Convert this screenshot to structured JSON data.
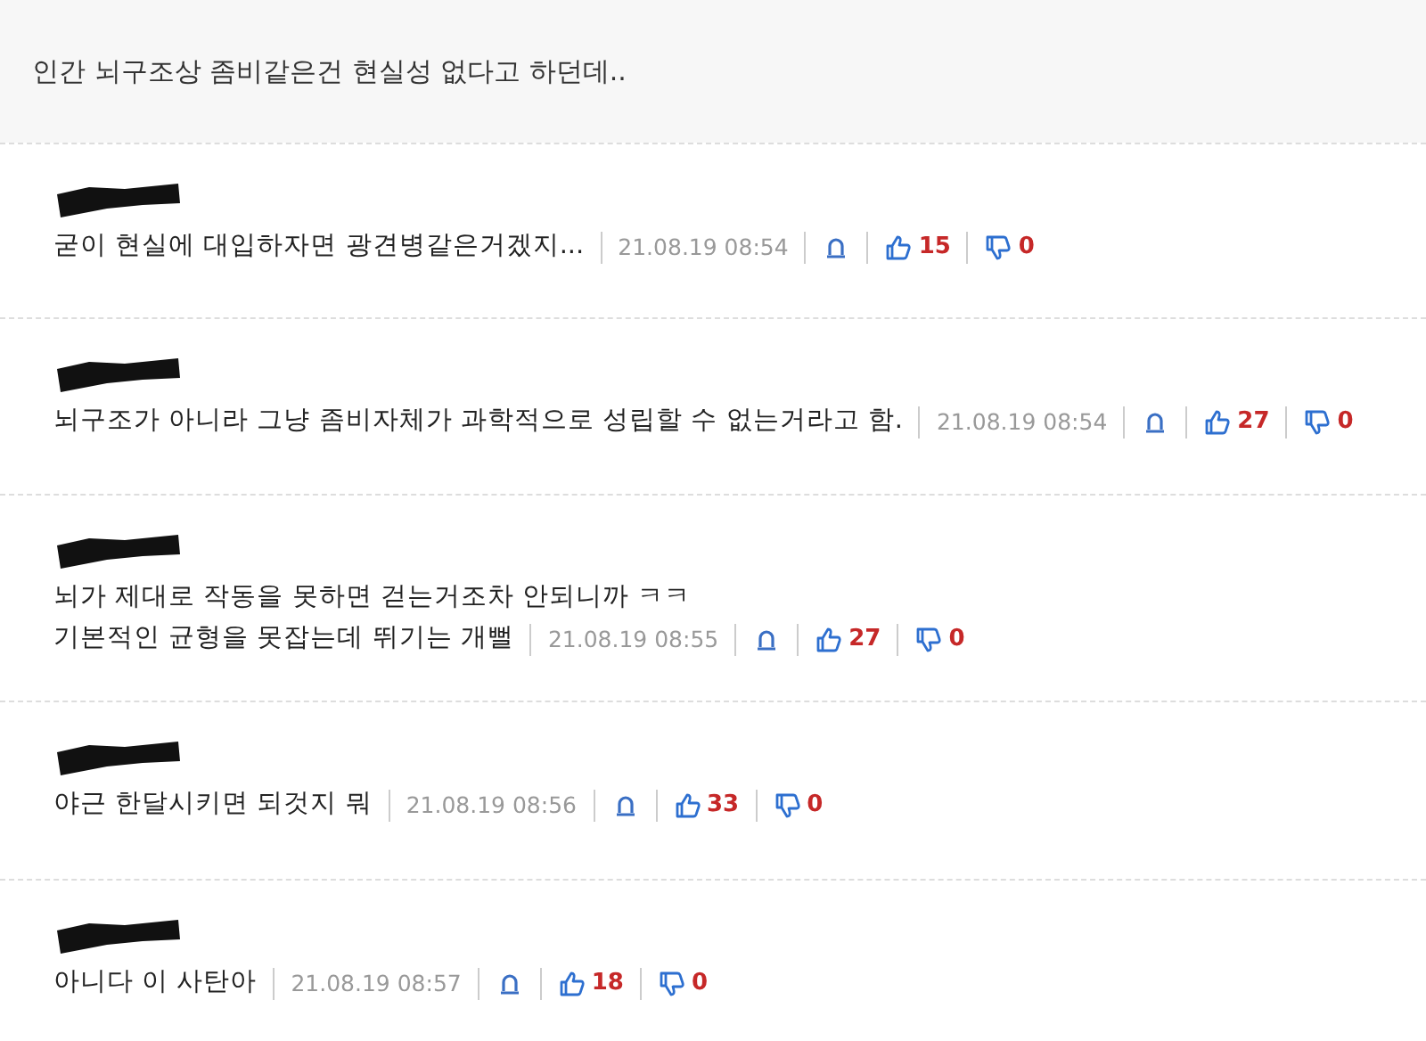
{
  "post": {
    "text": "인간 뇌구조상 좀비같은건 현실성 없다고 하던데.."
  },
  "comments": [
    {
      "lines": [
        "굳이 현실에 대입하자면 광견병같은거겠지..."
      ],
      "time": "21.08.19 08:54",
      "likes": "15",
      "dislikes": "0"
    },
    {
      "lines": [
        "뇌구조가 아니라 그냥 좀비자체가 과학적으로 성립할 수 없는거라고 함."
      ],
      "time": "21.08.19 08:54",
      "likes": "27",
      "dislikes": "0"
    },
    {
      "lines": [
        "뇌가 제대로 작동을 못하면 걷는거조차 안되니까 ㅋㅋ",
        "기본적인 균형을 못잡는데 뛰기는 개뻘"
      ],
      "time": "21.08.19 08:55",
      "likes": "27",
      "dislikes": "0"
    },
    {
      "lines": [
        "야근 한달시키면 되것지 뭐"
      ],
      "time": "21.08.19 08:56",
      "likes": "33",
      "dislikes": "0"
    },
    {
      "lines": [
        "아니다 이 사탄아"
      ],
      "time": "21.08.19 08:57",
      "likes": "18",
      "dislikes": "0"
    }
  ]
}
